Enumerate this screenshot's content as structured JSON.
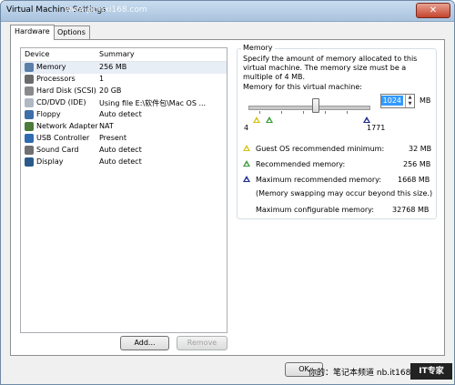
{
  "window": {
    "title": "Virtual Machine Settings",
    "watermark_top": "www.pcmxi168.com",
    "close_glyph": "✕"
  },
  "tabs": [
    {
      "label": "Hardware",
      "active": true
    },
    {
      "label": "Options",
      "active": false
    }
  ],
  "device_list": {
    "headers": {
      "device": "Device",
      "summary": "Summary"
    },
    "items": [
      {
        "icon": "memory-icon",
        "device": "Memory",
        "summary": "256 MB",
        "selected": true,
        "color": "#5a7fa8"
      },
      {
        "icon": "processor-icon",
        "device": "Processors",
        "summary": "1",
        "selected": false,
        "color": "#6b6b6b"
      },
      {
        "icon": "hard-disk-icon",
        "device": "Hard Disk (SCSI)",
        "summary": "20 GB",
        "selected": false,
        "color": "#8a8a8a"
      },
      {
        "icon": "cd-dvd-icon",
        "device": "CD/DVD (IDE)",
        "summary": "Using file E:\\软件包\\Mac OS ...",
        "selected": false,
        "color": "#b0b8c4"
      },
      {
        "icon": "floppy-icon",
        "device": "Floppy",
        "summary": "Auto detect",
        "selected": false,
        "color": "#3d6fa8"
      },
      {
        "icon": "network-adapter-icon",
        "device": "Network Adapter",
        "summary": "NAT",
        "selected": false,
        "color": "#4b7a3b"
      },
      {
        "icon": "usb-controller-icon",
        "device": "USB Controller",
        "summary": "Present",
        "selected": false,
        "color": "#2e6bb0"
      },
      {
        "icon": "sound-card-icon",
        "device": "Sound Card",
        "summary": "Auto detect",
        "selected": false,
        "color": "#707070"
      },
      {
        "icon": "display-icon",
        "device": "Display",
        "summary": "Auto detect",
        "selected": false,
        "color": "#2a5a8a"
      }
    ],
    "add_label": "Add...",
    "remove_label": "Remove"
  },
  "memory": {
    "group_title": "Memory",
    "description": "Specify the amount of memory allocated to this virtual machine. The memory size must be a multiple of 4 MB.",
    "slider_label": "Memory for this virtual machine:",
    "value": "1024",
    "unit": "MB",
    "slider_min_label": "4",
    "slider_max_label": "1771",
    "guest_min_label": "Guest OS recommended minimum:",
    "guest_min_value": "32 MB",
    "recommended_label": "Recommended memory:",
    "recommended_value": "256 MB",
    "max_recommended_label": "Maximum recommended memory:",
    "max_recommended_value": "1668 MB",
    "swap_note": "(Memory swapping may occur beyond this size.)",
    "max_configurable_label": "Maximum configurable memory:",
    "max_configurable_value": "32768 MB",
    "colors": {
      "guest_min": "#d4c21c",
      "recommended": "#3a9a3a",
      "max_recommended": "#1a2a8a"
    }
  },
  "footer": {
    "ok_label": "OK",
    "bottom_watermark": "你的：笔记本频道 nb.it168.com",
    "logo_text": "IT专家"
  }
}
